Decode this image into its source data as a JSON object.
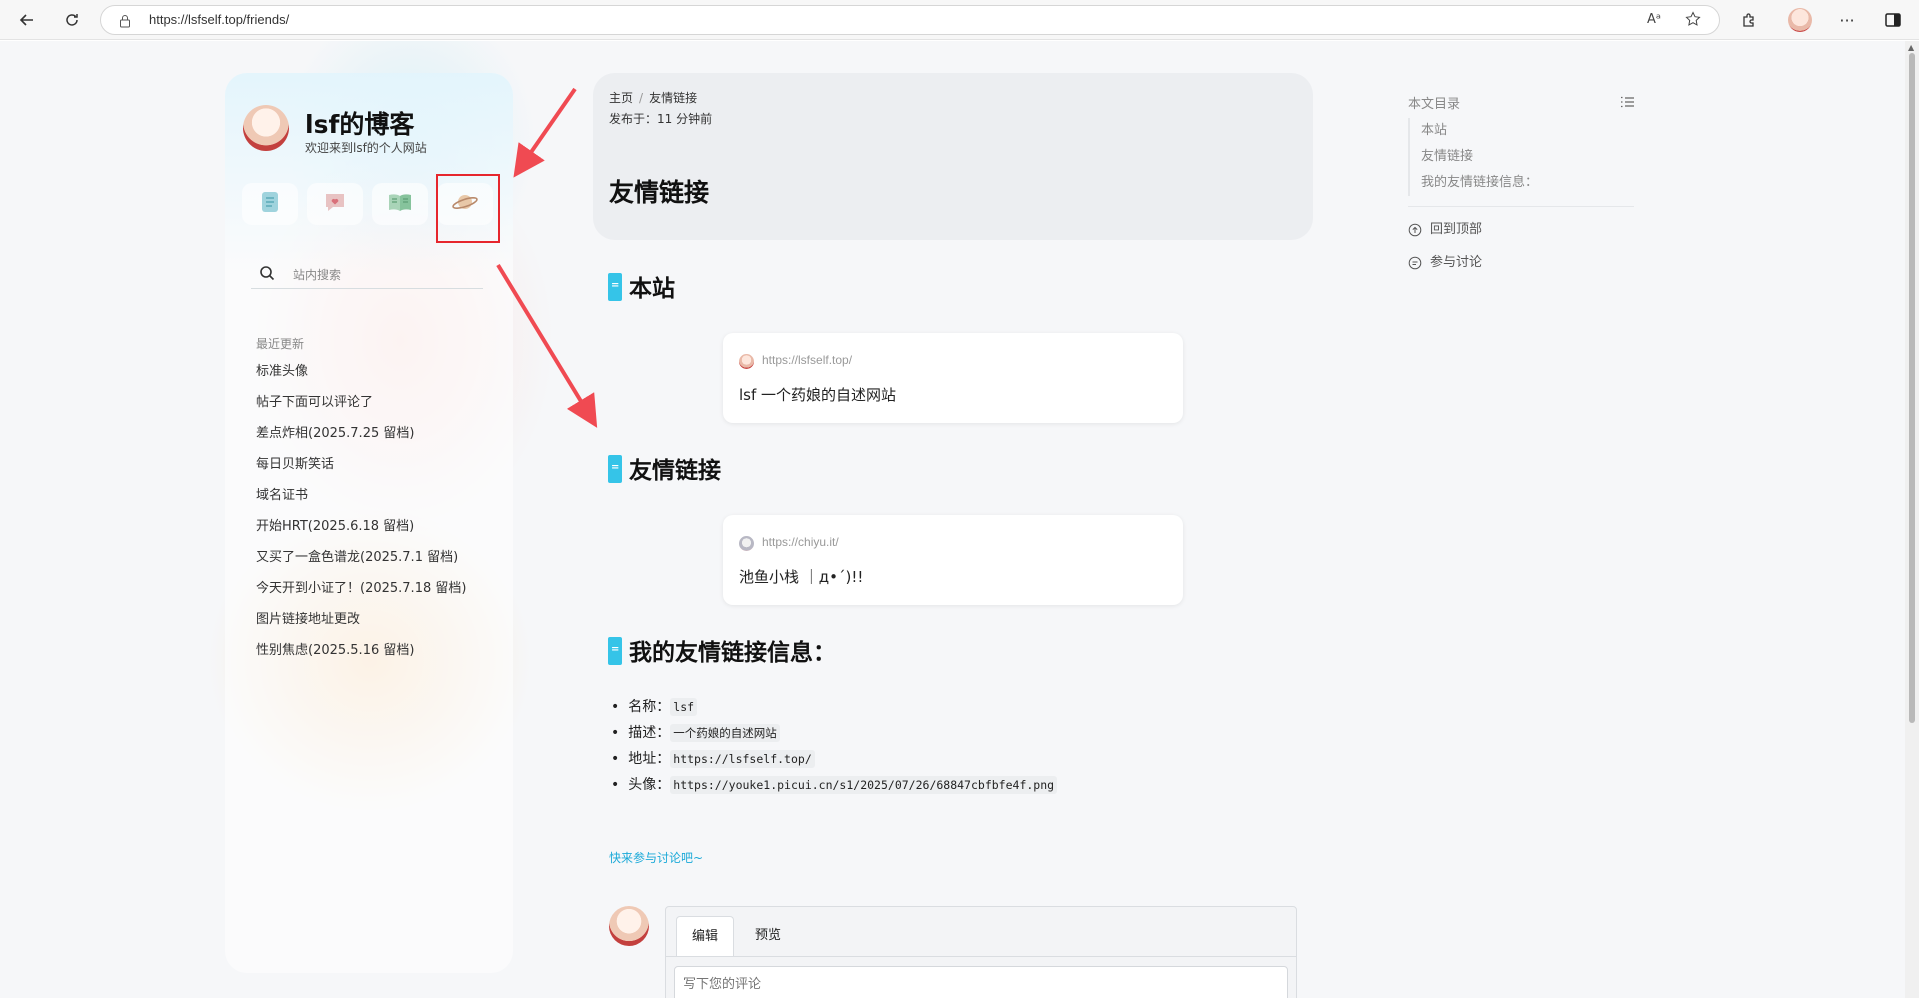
{
  "browser": {
    "url": "https://lsfself.top/friends/",
    "read_aloud": "Aᵃ"
  },
  "sidebar": {
    "title": "lsf的博客",
    "subtitle": "欢迎来到lsf的个人网站",
    "nav_icons": [
      "document-icon",
      "heart-message-icon",
      "book-icon",
      "planet-icon"
    ],
    "search_placeholder": "站内搜索",
    "recent_heading": "最近更新",
    "recent_items": [
      "标准头像",
      "帖子下面可以评论了",
      "差点炸相(2025.7.25 留档)",
      "每日贝斯笑话",
      "域名证书",
      "开始HRT(2025.6.18 留档)",
      "又买了一盒色谱龙(2025.7.1 留档)",
      "今天开到小证了！(2025.7.18 留档)",
      "图片链接地址更改",
      "性别焦虑(2025.5.16 留档)"
    ]
  },
  "header": {
    "breadcrumb_home": "主页",
    "breadcrumb_sep": "/",
    "breadcrumb_current": "友情链接",
    "published": "发布于：11 分钟前",
    "title": "友情链接"
  },
  "sections": {
    "site": "本站",
    "friends": "友情链接",
    "myinfo": "我的友情链接信息："
  },
  "cards": [
    {
      "url": "https://lsfself.top/",
      "desc": "lsf 一个药娘的自述网站"
    },
    {
      "url": "https://chiyu.it/",
      "desc": "池鱼小栈 ｜д•´)!!"
    }
  ],
  "info": {
    "name_label": "名称：",
    "name_value": "lsf",
    "desc_label": "描述：",
    "desc_value": "一个药娘的自述网站",
    "addr_label": "地址：",
    "addr_value": "https://lsfself.top/",
    "avatar_label": "头像：",
    "avatar_value": "https://youke1.picui.cn/s1/2025/07/26/68847cbfbfe4f.png"
  },
  "comment": {
    "prompt": "快来参与讨论吧~",
    "tab_edit": "编辑",
    "tab_preview": "预览",
    "placeholder": "写下您的评论"
  },
  "toc": {
    "heading": "本文目录",
    "items": [
      "本站",
      "友情链接",
      "我的友情链接信息："
    ],
    "back_to_top": "回到顶部",
    "join_discussion": "参与讨论"
  },
  "colors": {
    "accent": "#35c4e8",
    "annotation": "#e6262d",
    "link": "#1aa9d8"
  }
}
